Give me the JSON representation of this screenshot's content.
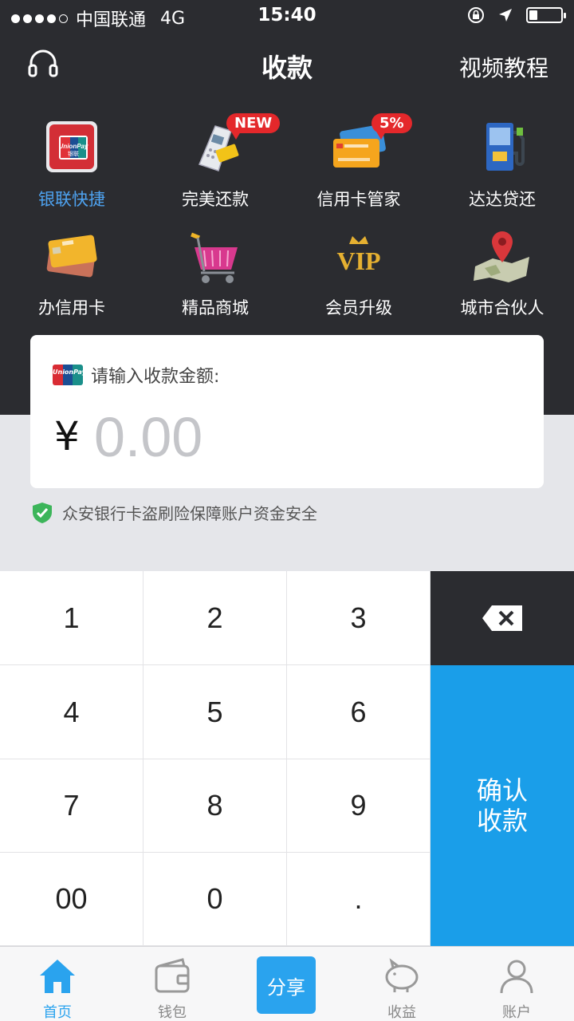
{
  "status_bar": {
    "carrier": "中国联通",
    "network": "4G",
    "time": "15:40"
  },
  "header": {
    "title": "收款",
    "right_link": "视频教程"
  },
  "grid": [
    {
      "label": "银联快捷",
      "icon": "unionpay-card-icon",
      "active": true
    },
    {
      "label": "完美还款",
      "icon": "card-terminal-icon",
      "badge": "NEW"
    },
    {
      "label": "信用卡管家",
      "icon": "credit-cards-icon",
      "badge": "5%"
    },
    {
      "label": "达达贷还",
      "icon": "atm-fuel-icon"
    },
    {
      "label": "办信用卡",
      "icon": "apply-card-icon"
    },
    {
      "label": "精品商城",
      "icon": "shopping-basket-icon"
    },
    {
      "label": "会员升级",
      "icon": "vip-crown-icon"
    },
    {
      "label": "城市合伙人",
      "icon": "map-pin-icon"
    }
  ],
  "amount_card": {
    "prompt": "请输入收款金额:",
    "currency": "¥",
    "amount": "0.00",
    "logo_text": "UnionPay"
  },
  "notice": "众安银行卡盗刷险保障账户资金安全",
  "keypad": {
    "keys": [
      "1",
      "2",
      "3",
      "4",
      "5",
      "6",
      "7",
      "8",
      "9",
      "00",
      "0",
      "."
    ],
    "confirm_line1": "确认",
    "confirm_line2": "收款"
  },
  "tabbar": {
    "home": "首页",
    "wallet": "钱包",
    "share": "分享",
    "income": "收益",
    "account": "账户"
  },
  "colors": {
    "dark": "#2b2c30",
    "accent": "#1a9ee9",
    "badge": "#e4282b",
    "active_label": "#4ea3f1"
  }
}
